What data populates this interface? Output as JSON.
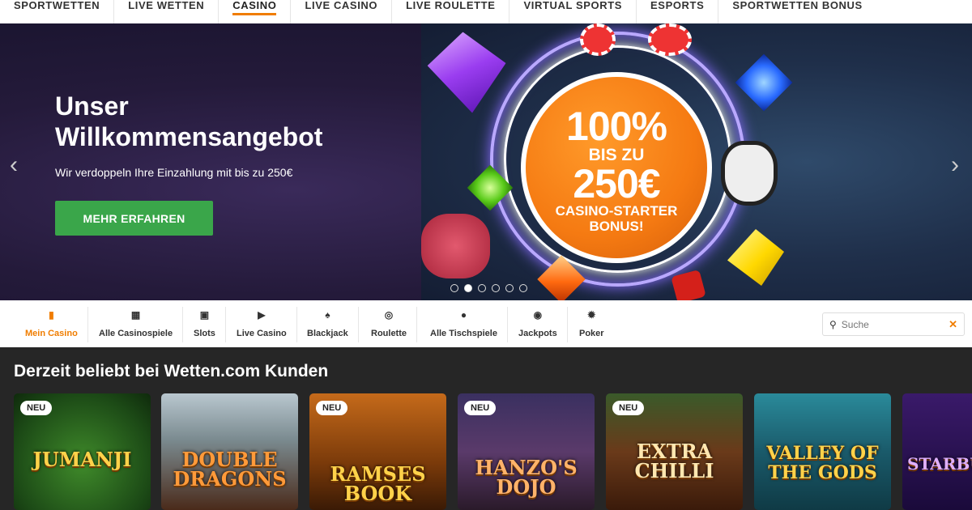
{
  "topnav": {
    "items": [
      "SPORTWETTEN",
      "LIVE WETTEN",
      "CASINO",
      "LIVE CASINO",
      "LIVE ROULETTE",
      "VIRTUAL SPORTS",
      "ESPORTS",
      "SPORTWETTEN BONUS"
    ],
    "active": "CASINO"
  },
  "hero": {
    "title": "Unser Willkommensangebot",
    "subtitle": "Wir verdoppeln Ihre Einzahlung mit bis zu 250€",
    "cta": "MEHR ERFAHREN",
    "badge": {
      "line1": "100%",
      "line2": "BIS ZU",
      "line3": "250€",
      "line4": "CASINO-STARTER",
      "line5": "BONUS!"
    },
    "slide_count": 6,
    "active_slide": 2
  },
  "categories": {
    "items": [
      {
        "label": "Mein Casino",
        "icon": "cards-stack-icon"
      },
      {
        "label": "Alle Casinospiele",
        "icon": "grid-icon"
      },
      {
        "label": "Slots",
        "icon": "slot-machine-icon"
      },
      {
        "label": "Live Casino",
        "icon": "video-camera-icon"
      },
      {
        "label": "Blackjack",
        "icon": "playing-card-icon"
      },
      {
        "label": "Roulette",
        "icon": "roulette-wheel-icon"
      },
      {
        "label": "Alle Tischspiele",
        "icon": "chips-icon"
      },
      {
        "label": "Jackpots",
        "icon": "money-bag-icon"
      },
      {
        "label": "Poker",
        "icon": "poker-chip-icon"
      }
    ],
    "active": "Mein Casino"
  },
  "search": {
    "placeholder": "Suche"
  },
  "games": {
    "heading": "Derzeit beliebt bei Wetten.com Kunden",
    "badge_label": "NEU",
    "tiles": [
      {
        "name": "JUMANJI",
        "neu": true
      },
      {
        "name": "DOUBLE DRAGONS",
        "neu": false
      },
      {
        "name": "RAMSES BOOK",
        "neu": true
      },
      {
        "name": "HANZO'S DOJO",
        "neu": true
      },
      {
        "name": "EXTRA CHILLI",
        "neu": true
      },
      {
        "name": "VALLEY OF THE GODS",
        "neu": false
      },
      {
        "name": "STARBURST",
        "neu": false
      }
    ]
  },
  "colors": {
    "accent": "#f07d00",
    "cta": "#3aa64a"
  }
}
